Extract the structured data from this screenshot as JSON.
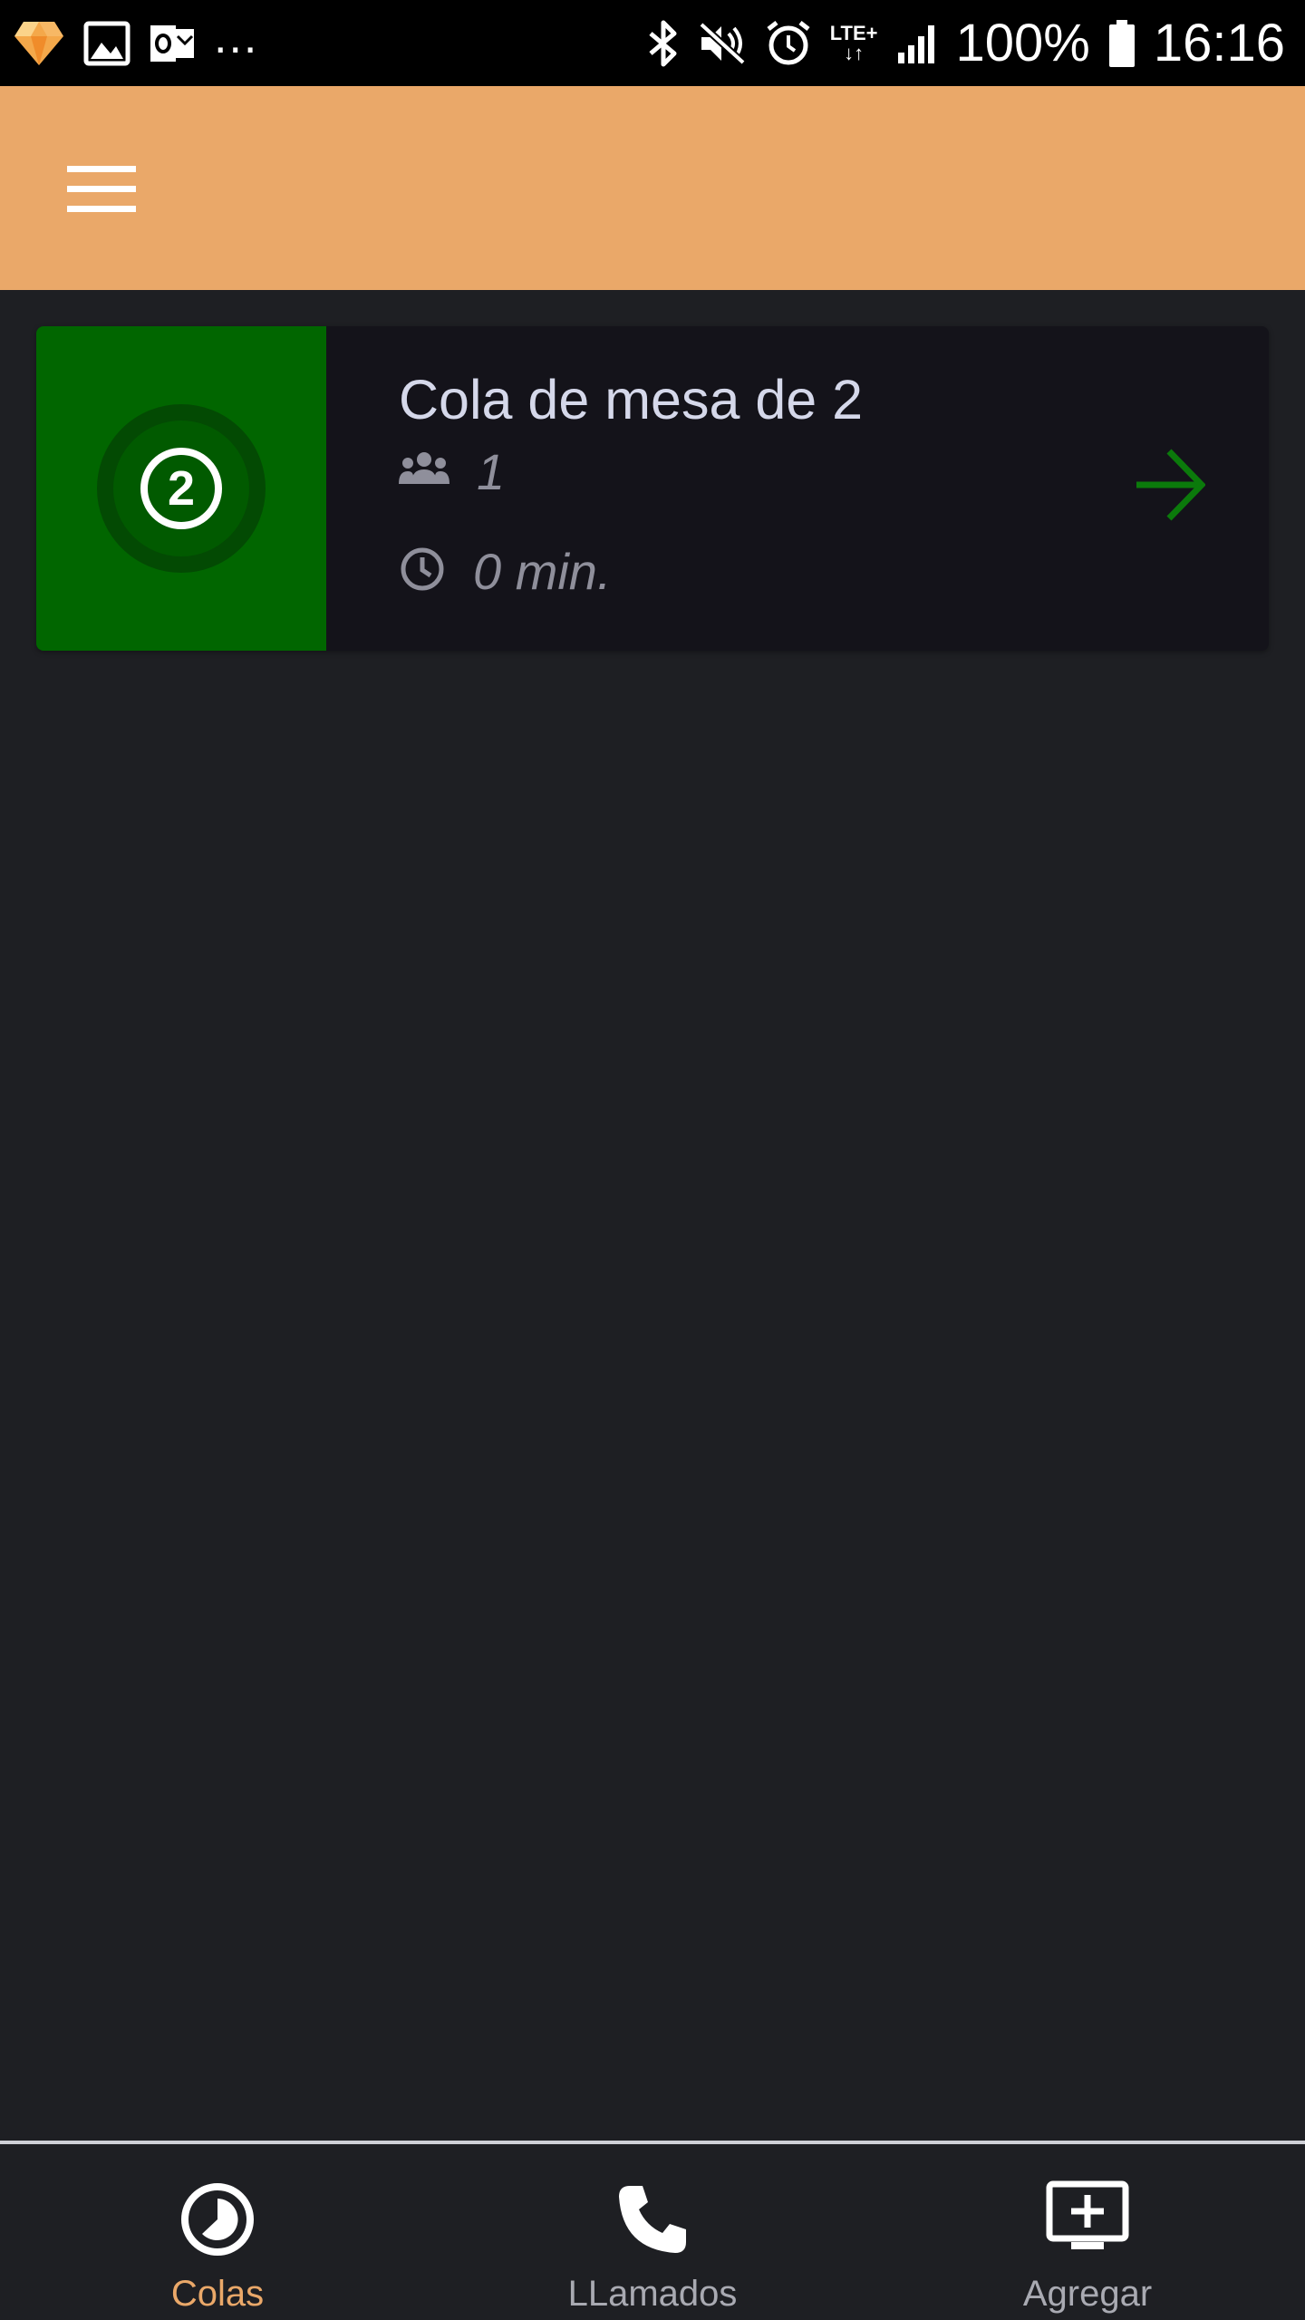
{
  "status_bar": {
    "left_icons": [
      "sketch-icon",
      "gallery-icon",
      "outlook-icon"
    ],
    "overflow": "...",
    "right_icons": [
      "bluetooth-icon",
      "mute-icon",
      "alarm-icon"
    ],
    "network_label_top": "LTE+",
    "network_label_bottom": "↓↑",
    "battery": "100%",
    "time": "16:16"
  },
  "app_bar": {
    "menu_icon": "hamburger-menu-icon",
    "color": "#eaa869"
  },
  "queues": [
    {
      "badge_number": "2",
      "title": "Cola de mesa de 2",
      "people_count": "1",
      "wait_time": "0 min.",
      "badge_color": "#016600",
      "arrow_color": "#0b7a0b"
    }
  ],
  "bottom_nav": {
    "items": [
      {
        "label": "Colas",
        "icon": "timer-icon",
        "active": true
      },
      {
        "label": "LLamados",
        "icon": "phone-icon",
        "active": false
      },
      {
        "label": "Agregar",
        "icon": "add-screen-icon",
        "active": false
      }
    ],
    "active_color": "#eaa869",
    "inactive_color": "#a9aab2"
  }
}
